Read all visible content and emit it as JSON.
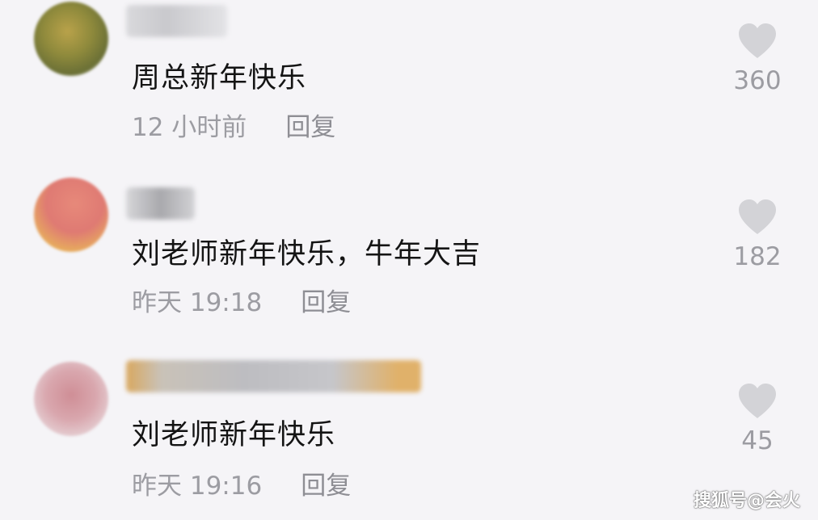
{
  "comments": [
    {
      "text": "周总新年快乐",
      "time": "12 小时前",
      "reply_label": "回复",
      "likes": "360"
    },
    {
      "text": "刘老师新年快乐，牛年大吉",
      "time": "昨天 19:18",
      "reply_label": "回复",
      "likes": "182"
    },
    {
      "text": "刘老师新年快乐",
      "time": "昨天 19:16",
      "reply_label": "回复",
      "likes": "45"
    }
  ],
  "icons": {
    "like": "heart-icon"
  },
  "colors": {
    "background": "#f5f4f7",
    "text": "#141414",
    "meta": "#9c9ca2",
    "heart": "#d3d3d7"
  },
  "watermark": "搜狐号@会火"
}
